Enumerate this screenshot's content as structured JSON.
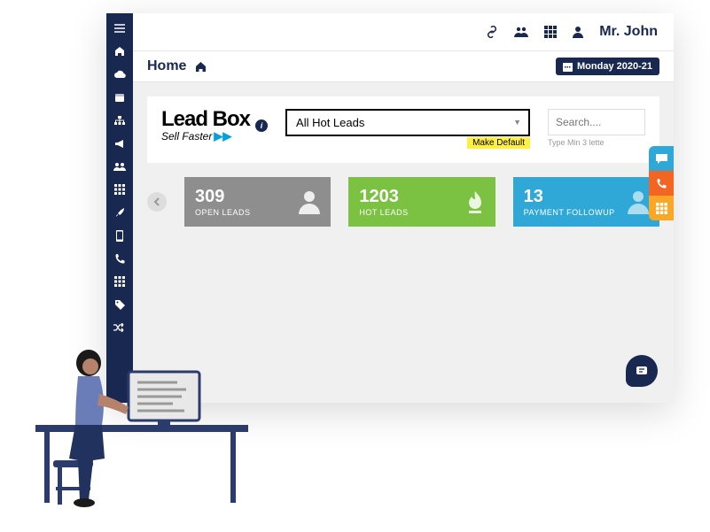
{
  "header": {
    "user_name": "Mr. John"
  },
  "breadcrumb": {
    "title": "Home",
    "date_label": "Monday 2020-21"
  },
  "logo": {
    "main": "Lead Box",
    "sub": "Sell Faster",
    "arrows": "▶▶"
  },
  "filter": {
    "selected": "All Hot Leads",
    "make_default_label": "Make Default"
  },
  "search": {
    "placeholder": "Search....",
    "hint": "Type Min 3 lette"
  },
  "stats": [
    {
      "number": "309",
      "label": "OPEN LEADS"
    },
    {
      "number": "1203",
      "label": "HOT LEADS"
    },
    {
      "number": "13",
      "label": "PAYMENT FOLLOWUP"
    }
  ]
}
